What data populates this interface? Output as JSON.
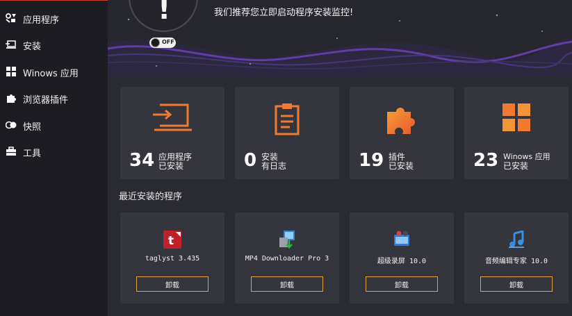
{
  "sidebar": {
    "items": [
      {
        "label": "应用程序",
        "icon": "apps-icon"
      },
      {
        "label": "安装",
        "icon": "install-icon"
      },
      {
        "label": "Winows 应用",
        "icon": "windows-grid-icon"
      },
      {
        "label": "浏览器插件",
        "icon": "puzzle-icon"
      },
      {
        "label": "快照",
        "icon": "snapshot-icon"
      },
      {
        "label": "工具",
        "icon": "toolbox-icon"
      }
    ]
  },
  "banner": {
    "message": "我们推荐您立即启动程序安装监控!",
    "alert_symbol": "!",
    "toggle_label": "OFF",
    "toggle_state": "off"
  },
  "stats": [
    {
      "number": "34",
      "line1": "应用程序",
      "line2": "已安装",
      "icon": "laptop-install-icon"
    },
    {
      "number": "0",
      "line1": "安装",
      "line2": "有日志",
      "icon": "clipboard-log-icon"
    },
    {
      "number": "19",
      "line1": "插件",
      "line2": "已安装",
      "icon": "puzzle-icon"
    },
    {
      "number": "23",
      "line1": "Winows 应用",
      "line2": "已安装",
      "icon": "windows-grid-icon"
    }
  ],
  "recent": {
    "title": "最近安装的程序",
    "apps": [
      {
        "name": "taglyst 3.435",
        "button": "卸载",
        "icon": "taglyst-icon"
      },
      {
        "name": "MP4 Downloader Pro 3",
        "button": "卸载",
        "icon": "mp4-downloader-icon"
      },
      {
        "name": "超级录屏 10.0",
        "button": "卸载",
        "icon": "screen-recorder-icon"
      },
      {
        "name": "音频编辑专家 10.0",
        "button": "卸载",
        "icon": "audio-editor-icon"
      }
    ]
  },
  "colors": {
    "accent_orange": "#f07a32",
    "button_border": "#e8a23a",
    "sidebar_bg": "#1c1c22",
    "card_bg": "#35353d",
    "wave_purple": "#6a3fb5"
  }
}
